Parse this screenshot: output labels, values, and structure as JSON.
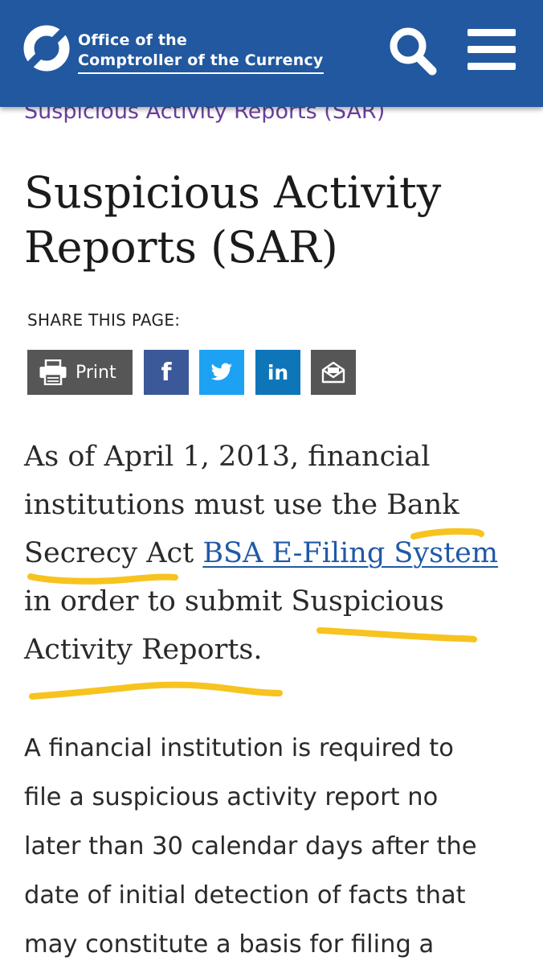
{
  "header": {
    "logo_line1": "Office of the",
    "logo_line2": "Comptroller of the Currency",
    "search_label": "Search",
    "menu_label": "Menu",
    "background_color": "#22589f"
  },
  "breadcrumb": {
    "current": "Suspicious Activity Reports (SAR)"
  },
  "page": {
    "title": "Suspicious Activity Reports (SAR)"
  },
  "share": {
    "label": "SHARE THIS PAGE:",
    "print_label": "Print",
    "facebook_glyph": "f",
    "linkedin_glyph": "in",
    "facebook_color": "#3b5998",
    "twitter_color": "#1da1f2",
    "linkedin_color": "#0e76b8",
    "print_color": "#565656",
    "email_color": "#565656",
    "icons": [
      "printer-icon",
      "facebook-icon",
      "twitter-icon",
      "linkedin-icon",
      "email-icon"
    ]
  },
  "content": {
    "para1": {
      "line1": "As of April 1, 2013, financial",
      "line2": "institutions must use the Bank",
      "line3_text": "Secrecy Act ",
      "link_text": "BSA E-Filing System",
      "line4": "in order to submit Suspicious",
      "line5": "Activity Reports."
    },
    "para2": {
      "line1": "A financial institution is required to",
      "line2": "file a suspicious activity report no",
      "line3": "later than 30 calendar days after the",
      "line4": "date of initial detection of facts that",
      "line5": "may constitute a basis for filing a"
    }
  },
  "annotations": {
    "highlight_color": "#f7c31f"
  }
}
